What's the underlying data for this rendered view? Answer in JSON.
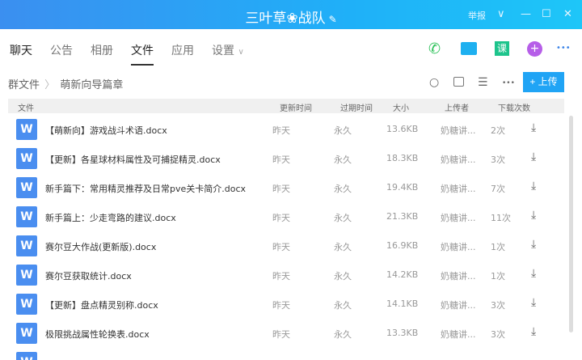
{
  "window": {
    "title": "三叶草❀战队",
    "report": "举报",
    "edit_icon": "✎",
    "dropdown_icon": "∨",
    "minimize": "—",
    "maximize": "☐",
    "close": "✕"
  },
  "tabs": [
    "聊天",
    "公告",
    "相册",
    "文件",
    "应用",
    "设置"
  ],
  "tabs_settings_caret": "∨",
  "active_tab": "文件",
  "breadcrumb": {
    "root": "群文件",
    "sep": "〉",
    "current": "萌新向导篇章"
  },
  "toolbar": {
    "upload": "+ 上传",
    "more": "•••",
    "course": "课"
  },
  "columns": {
    "file": "文件",
    "updated": "更新时间",
    "expires": "过期时间",
    "size": "大小",
    "uploader": "上传者",
    "downloads": "下载次数"
  },
  "files": [
    {
      "name": "【萌新向】游戏战斗术语.docx",
      "updated": "昨天",
      "expires": "永久",
      "size": "13.6KB",
      "uploader": "奶糖讲...",
      "downloads": "2次"
    },
    {
      "name": "【更新】各星球材料属性及可捕捉精灵.docx",
      "updated": "昨天",
      "expires": "永久",
      "size": "18.3KB",
      "uploader": "奶糖讲...",
      "downloads": "3次"
    },
    {
      "name": "新手篇下：常用精灵推荐及日常pve关卡简介.docx",
      "updated": "昨天",
      "expires": "永久",
      "size": "19.4KB",
      "uploader": "奶糖讲...",
      "downloads": "7次"
    },
    {
      "name": "新手篇上：少走弯路的建议.docx",
      "updated": "昨天",
      "expires": "永久",
      "size": "21.3KB",
      "uploader": "奶糖讲...",
      "downloads": "11次"
    },
    {
      "name": "赛尔豆大作战(更新版).docx",
      "updated": "昨天",
      "expires": "永久",
      "size": "16.9KB",
      "uploader": "奶糖讲...",
      "downloads": "1次"
    },
    {
      "name": "赛尔豆获取统计.docx",
      "updated": "昨天",
      "expires": "永久",
      "size": "14.2KB",
      "uploader": "奶糖讲...",
      "downloads": "1次"
    },
    {
      "name": "【更新】盘点精灵别称.docx",
      "updated": "昨天",
      "expires": "永久",
      "size": "14.1KB",
      "uploader": "奶糖讲...",
      "downloads": "3次"
    },
    {
      "name": "极限挑战属性轮换表.docx",
      "updated": "昨天",
      "expires": "永久",
      "size": "13.3KB",
      "uploader": "奶糖讲...",
      "downloads": "3次"
    }
  ],
  "file_icon_letter": "W"
}
